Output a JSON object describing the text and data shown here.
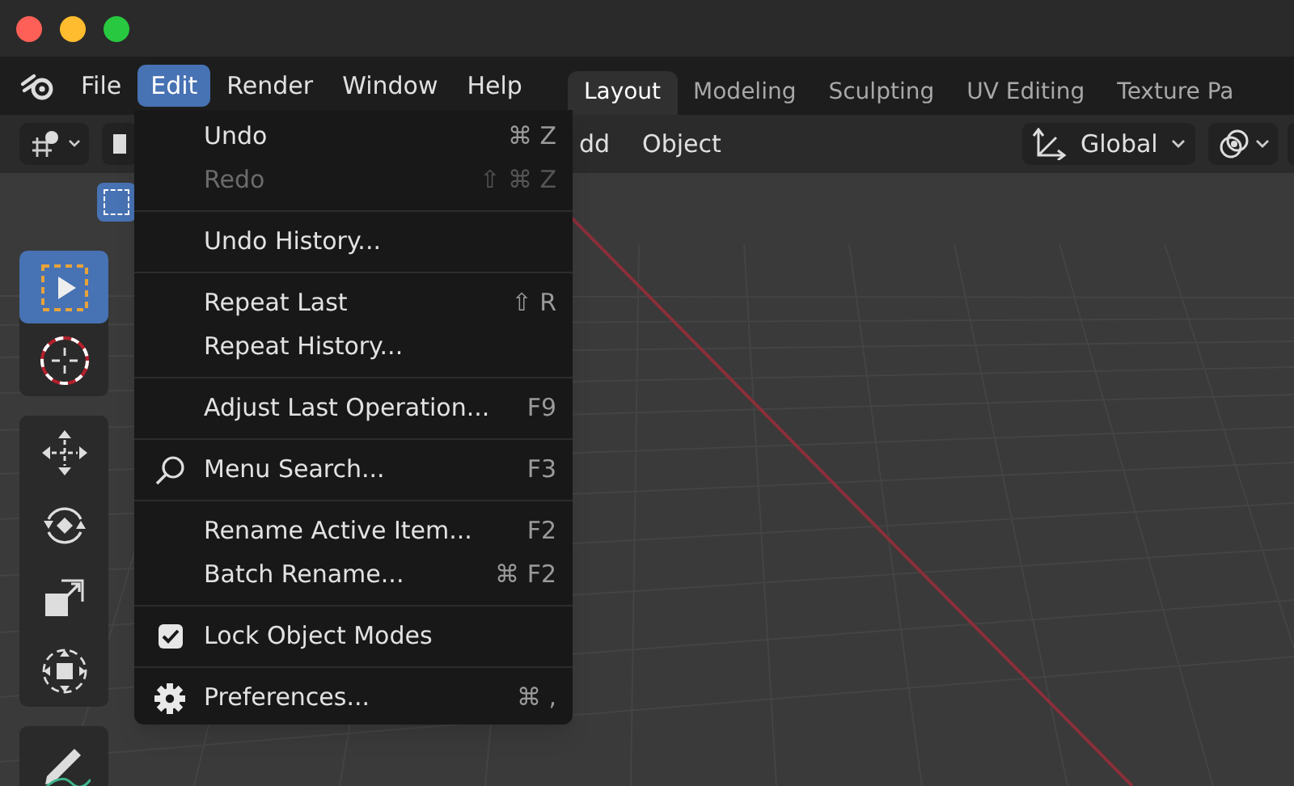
{
  "menubar": {
    "items": [
      {
        "label": "File",
        "selected": false
      },
      {
        "label": "Edit",
        "selected": true
      },
      {
        "label": "Render",
        "selected": false
      },
      {
        "label": "Window",
        "selected": false
      },
      {
        "label": "Help",
        "selected": false
      }
    ]
  },
  "workspaces": [
    {
      "label": "Layout",
      "selected": true
    },
    {
      "label": "Modeling",
      "selected": false
    },
    {
      "label": "Sculpting",
      "selected": false
    },
    {
      "label": "UV Editing",
      "selected": false
    },
    {
      "label": "Texture Pa",
      "selected": false
    }
  ],
  "header": {
    "menu_items": [
      "dd",
      "Object"
    ],
    "orientation": "Global"
  },
  "edit_menu": [
    {
      "kind": "item",
      "label": "Undo",
      "shortcut": "⌘ Z",
      "disabled": false
    },
    {
      "kind": "item",
      "label": "Redo",
      "shortcut": "⇧ ⌘ Z",
      "disabled": true
    },
    {
      "kind": "separator"
    },
    {
      "kind": "item",
      "label": "Undo History...",
      "disabled": false
    },
    {
      "kind": "separator"
    },
    {
      "kind": "item",
      "label": "Repeat Last",
      "shortcut": "⇧ R",
      "disabled": false
    },
    {
      "kind": "item",
      "label": "Repeat History...",
      "disabled": false
    },
    {
      "kind": "separator"
    },
    {
      "kind": "item",
      "label": "Adjust Last Operation...",
      "shortcut": "F9",
      "disabled": false
    },
    {
      "kind": "separator"
    },
    {
      "kind": "search",
      "label": "Menu Search...",
      "shortcut": "F3",
      "disabled": false
    },
    {
      "kind": "separator"
    },
    {
      "kind": "item",
      "label": "Rename Active Item...",
      "shortcut": "F2",
      "disabled": false
    },
    {
      "kind": "item",
      "label": "Batch Rename...",
      "shortcut": "⌘ F2",
      "disabled": false
    },
    {
      "kind": "separator"
    },
    {
      "kind": "check",
      "label": "Lock Object Modes",
      "checked": true,
      "disabled": false
    },
    {
      "kind": "separator"
    },
    {
      "kind": "gear",
      "label": "Preferences...",
      "shortcut": "⌘ ,",
      "disabled": false
    }
  ],
  "tools": [
    {
      "kind": "select",
      "selected": true
    },
    {
      "kind": "cursor",
      "selected": false
    },
    {
      "kind": "gap"
    },
    {
      "kind": "move",
      "selected": false
    },
    {
      "kind": "rotate",
      "selected": false
    },
    {
      "kind": "scale",
      "selected": false
    },
    {
      "kind": "transform",
      "selected": false
    },
    {
      "kind": "gap"
    },
    {
      "kind": "annotate",
      "selected": false
    }
  ]
}
